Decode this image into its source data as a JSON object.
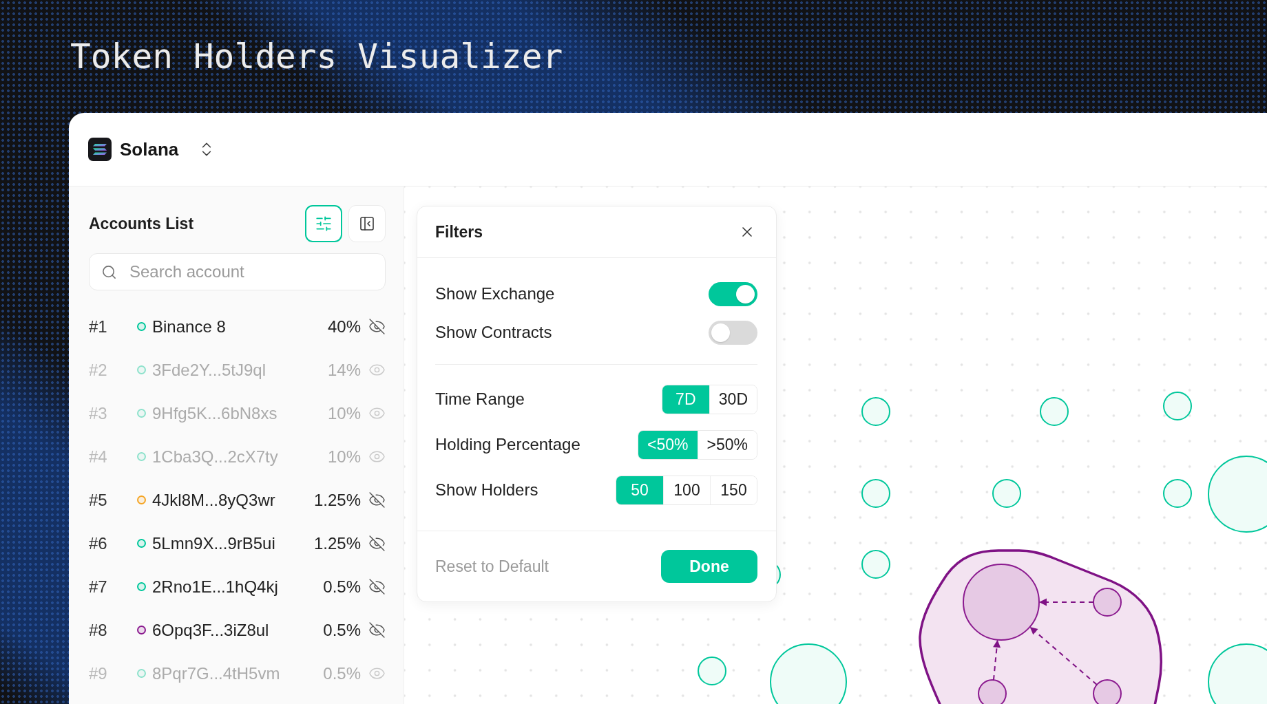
{
  "page": {
    "title": "Token Holders Visualizer"
  },
  "network": {
    "name": "Solana"
  },
  "sidebar": {
    "title": "Accounts List",
    "filter_button": {
      "selected": true
    },
    "search": {
      "placeholder": "Search account"
    },
    "accounts": [
      {
        "rank": "#1",
        "name": "Binance 8",
        "share": "40%",
        "color": "#00c79b",
        "hidden": false
      },
      {
        "rank": "#2",
        "name": "3Fde2Y...5tJ9ql",
        "share": "14%",
        "color": "#8ee2cc",
        "hidden": true
      },
      {
        "rank": "#3",
        "name": "9Hfg5K...6bN8xs",
        "share": "10%",
        "color": "#8ee2cc",
        "hidden": true
      },
      {
        "rank": "#4",
        "name": "1Cba3Q...2cX7ty",
        "share": "10%",
        "color": "#8ee2cc",
        "hidden": true
      },
      {
        "rank": "#5",
        "name": "4Jkl8M...8yQ3wr",
        "share": "1.25%",
        "color": "#f5a524",
        "hidden": false
      },
      {
        "rank": "#6",
        "name": "5Lmn9X...9rB5ui",
        "share": "1.25%",
        "color": "#00c79b",
        "hidden": false
      },
      {
        "rank": "#7",
        "name": "2Rno1E...1hQ4kj",
        "share": "0.5%",
        "color": "#00c79b",
        "hidden": false
      },
      {
        "rank": "#8",
        "name": "6Opq3F...3iZ8ul",
        "share": "0.5%",
        "color": "#8b1a8f",
        "hidden": false
      },
      {
        "rank": "#9",
        "name": "8Pqr7G...4tH5vm",
        "share": "0.5%",
        "color": "#8ee2cc",
        "hidden": true
      }
    ]
  },
  "filters": {
    "title": "Filters",
    "toggles": [
      {
        "label": "Show Exchange",
        "on": true
      },
      {
        "label": "Show Contracts",
        "on": false
      }
    ],
    "options": [
      {
        "label": "Time Range",
        "choices": [
          {
            "label": "7D",
            "selected": true
          },
          {
            "label": "30D",
            "selected": false
          }
        ]
      },
      {
        "label": "Holding Percentage",
        "choices": [
          {
            "label": "<50%",
            "selected": true
          },
          {
            "label": ">50%",
            "selected": false
          }
        ]
      },
      {
        "label": "Show Holders",
        "choices": [
          {
            "label": "50",
            "selected": true
          },
          {
            "label": "100",
            "selected": false
          },
          {
            "label": "150",
            "selected": false
          }
        ]
      }
    ],
    "reset": "Reset to Default",
    "done": "Done"
  }
}
